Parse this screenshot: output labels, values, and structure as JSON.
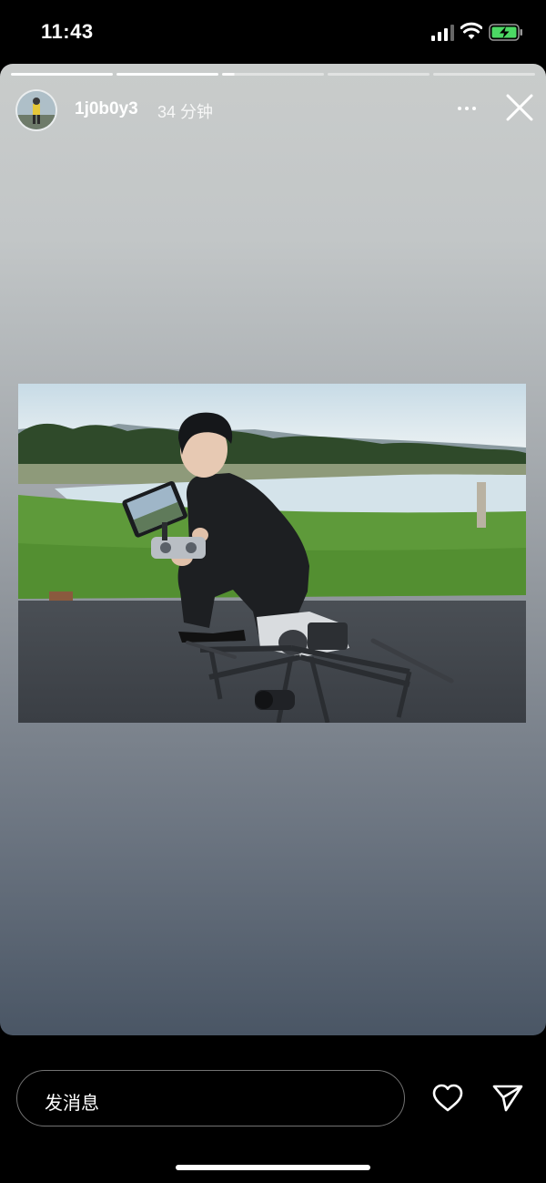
{
  "status_bar": {
    "time": "11:43"
  },
  "story": {
    "progress": {
      "total_segments": 5,
      "completed_segments": 2,
      "current_segment_fraction": 0.12
    },
    "username": "1j0b0y3",
    "time_ago": "34 分钟",
    "icons": {
      "more": "more-horizontal-icon",
      "close": "close-icon"
    }
  },
  "composer": {
    "placeholder": "发消息",
    "icons": {
      "like": "heart-icon",
      "share": "send-icon"
    }
  },
  "colors": {
    "battery_charging": "#4cd964",
    "card_top": "#c9cccb",
    "card_bottom": "#4a5665"
  }
}
